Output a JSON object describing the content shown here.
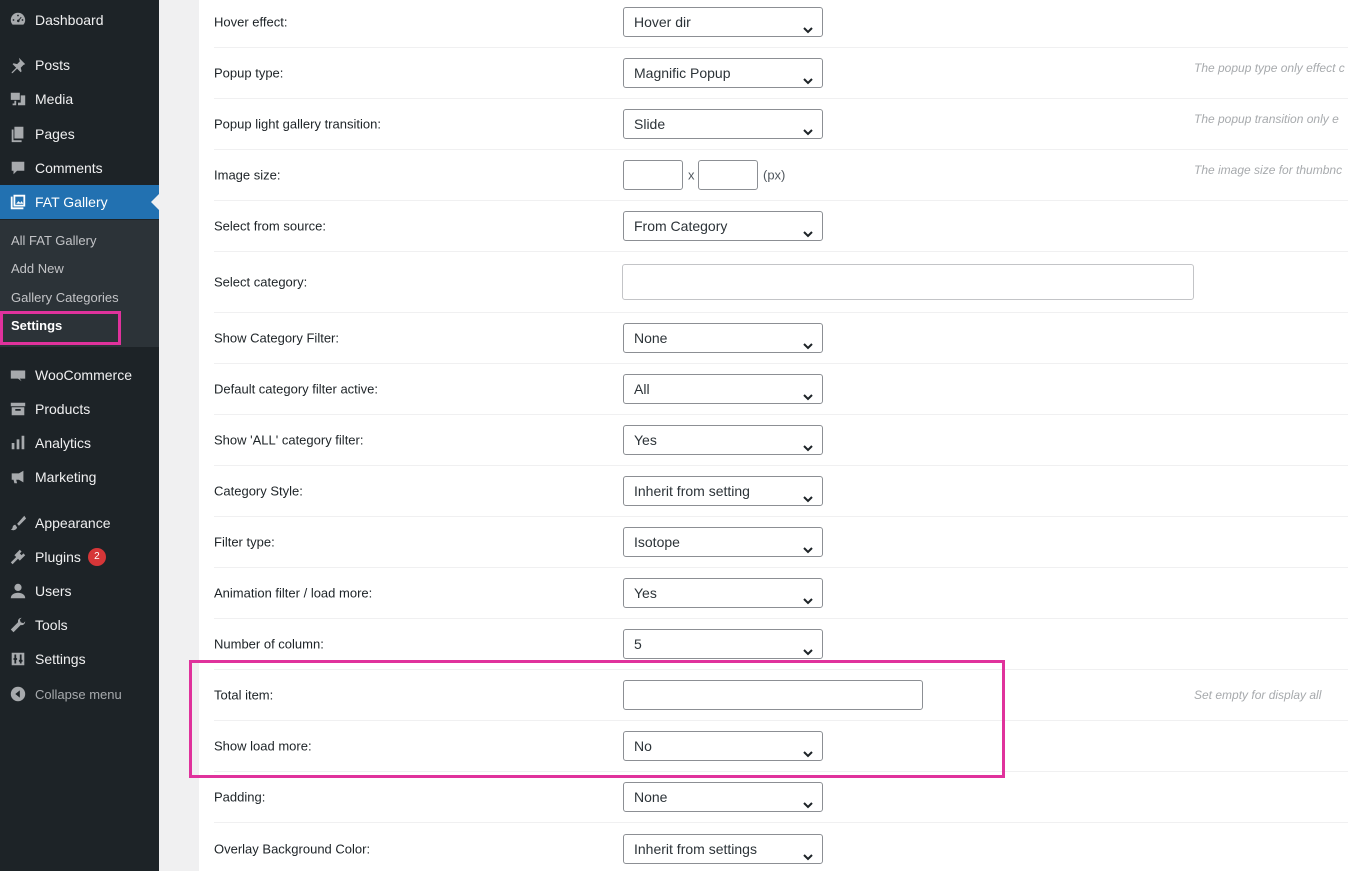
{
  "sidebar": {
    "menu": [
      {
        "label": "Dashboard",
        "icon": "dashboard-icon"
      },
      {
        "label": "Posts",
        "icon": "pin-icon"
      },
      {
        "label": "Media",
        "icon": "media-icon"
      },
      {
        "label": "Pages",
        "icon": "pages-icon"
      },
      {
        "label": "Comments",
        "icon": "comments-icon"
      },
      {
        "label": "FAT Gallery",
        "icon": "gallery-icon"
      }
    ],
    "submenu": [
      "All FAT Gallery",
      "Add New",
      "Gallery Categories",
      "Settings"
    ],
    "menu2": [
      {
        "label": "WooCommerce",
        "icon": "woo-icon"
      },
      {
        "label": "Products",
        "icon": "products-icon"
      },
      {
        "label": "Analytics",
        "icon": "analytics-icon"
      },
      {
        "label": "Marketing",
        "icon": "megaphone-icon"
      },
      {
        "label": "Appearance",
        "icon": "brush-icon"
      },
      {
        "label": "Plugins",
        "icon": "plugin-icon",
        "badge": "2"
      },
      {
        "label": "Users",
        "icon": "user-icon"
      },
      {
        "label": "Tools",
        "icon": "wrench-icon"
      },
      {
        "label": "Settings",
        "icon": "settings-icon"
      }
    ],
    "collapse": "Collapse menu"
  },
  "settings": {
    "hover_effect": {
      "label": "Hover effect:",
      "value": "Hover dir"
    },
    "popup_type": {
      "label": "Popup type:",
      "value": "Magnific Popup",
      "help": "The popup type only effect c"
    },
    "popup_transition": {
      "label": "Popup light gallery transition:",
      "value": "Slide",
      "help": "The popup transition only e"
    },
    "image_size": {
      "label": "Image size:",
      "separator": "x",
      "unit": "(px)",
      "help": "The image size for thumbnc"
    },
    "source": {
      "label": "Select from source:",
      "value": "From Category"
    },
    "category": {
      "label": "Select category:"
    },
    "show_category_filter": {
      "label": "Show Category Filter:",
      "value": "None"
    },
    "default_filter_active": {
      "label": "Default category filter active:",
      "value": "All"
    },
    "show_all_filter": {
      "label": "Show 'ALL' category filter:",
      "value": "Yes"
    },
    "category_style": {
      "label": "Category Style:",
      "value": "Inherit from setting"
    },
    "filter_type": {
      "label": "Filter type:",
      "value": "Isotope"
    },
    "animation_filter": {
      "label": "Animation filter / load more:",
      "value": "Yes"
    },
    "columns": {
      "label": "Number of column:",
      "value": "5"
    },
    "total_item": {
      "label": "Total item:",
      "help": "Set empty for display all"
    },
    "show_load_more": {
      "label": "Show load more:",
      "value": "No"
    },
    "padding": {
      "label": "Padding:",
      "value": "None"
    },
    "overlay_bg": {
      "label": "Overlay Background Color:",
      "value": "Inherit from settings"
    }
  },
  "colors": {
    "sidebar_bg": "#1d2327",
    "active": "#2271b1",
    "highlight": "#e0329c",
    "badge": "#d63638"
  }
}
